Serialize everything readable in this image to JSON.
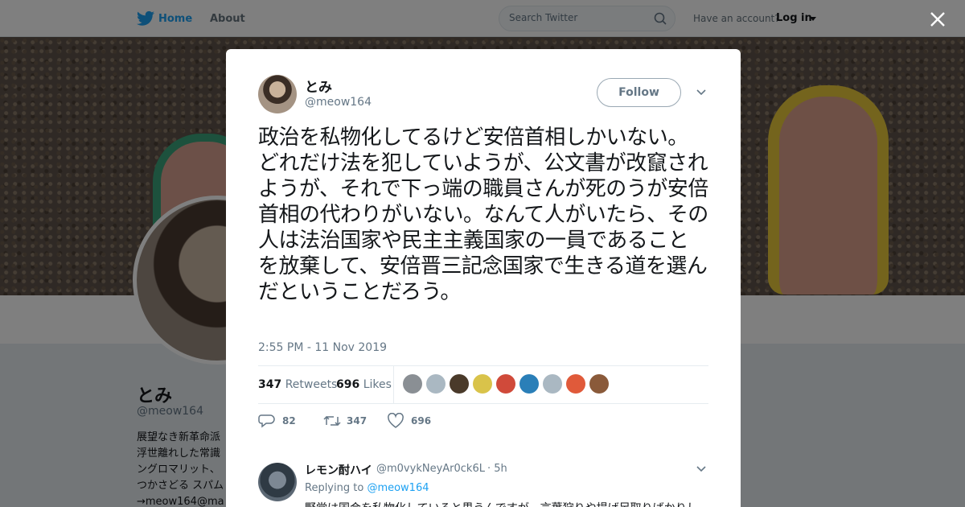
{
  "nav": {
    "home": "Home",
    "about": "About",
    "search_placeholder": "Search Twitter",
    "have_account": "Have an account?",
    "login": "Log in"
  },
  "profile": {
    "name": "とみ",
    "handle": "@meow164",
    "bio": [
      "展望なき新革命派",
      "浮世離れした常識",
      "ングロマリット、",
      "つかさどる スパム",
      "→meow164@ma"
    ]
  },
  "tweet": {
    "author_name": "とみ",
    "author_handle": "@meow164",
    "follow_label": "Follow",
    "text": "政治を私物化してるけど安倍首相しかいない。どれだけ法を犯していようが、公文書が改竄されようが、それで下っ端の職員さんが死のうが安倍首相の代わりがいない。なんて人がいたら、その人は法治国家や民主主義国家の一員であることを放棄して、安倍晋三記念国家で生きる道を選んだということだろう。",
    "timestamp": "2:55 PM - 11 Nov 2019",
    "retweets_count": "347",
    "retweets_label": "Retweets",
    "likes_count": "696",
    "likes_label": "Likes",
    "liker_colors": [
      "#8a8f94",
      "#aab8c2",
      "#4a3a2a",
      "#d9c34a",
      "#d04a3a",
      "#2a7fb8",
      "#aab8c2",
      "#e05a3a",
      "#8a5a3a"
    ],
    "actions": {
      "replies": "82",
      "retweets": "347",
      "likes": "696"
    }
  },
  "reply": {
    "name": "レモン酎ハイ",
    "handle": "@m0vykNeyAr0ck6L",
    "time": "· 5h",
    "replying_to_label": "Replying to",
    "replying_to_handle": "@meow164",
    "text": "野党は国会を私物化していると思うんですが。言葉狩りや揚げ足取りばかりし"
  },
  "colors": {
    "accent": "#1da1f2",
    "text": "#14171a",
    "muted": "#657786"
  }
}
